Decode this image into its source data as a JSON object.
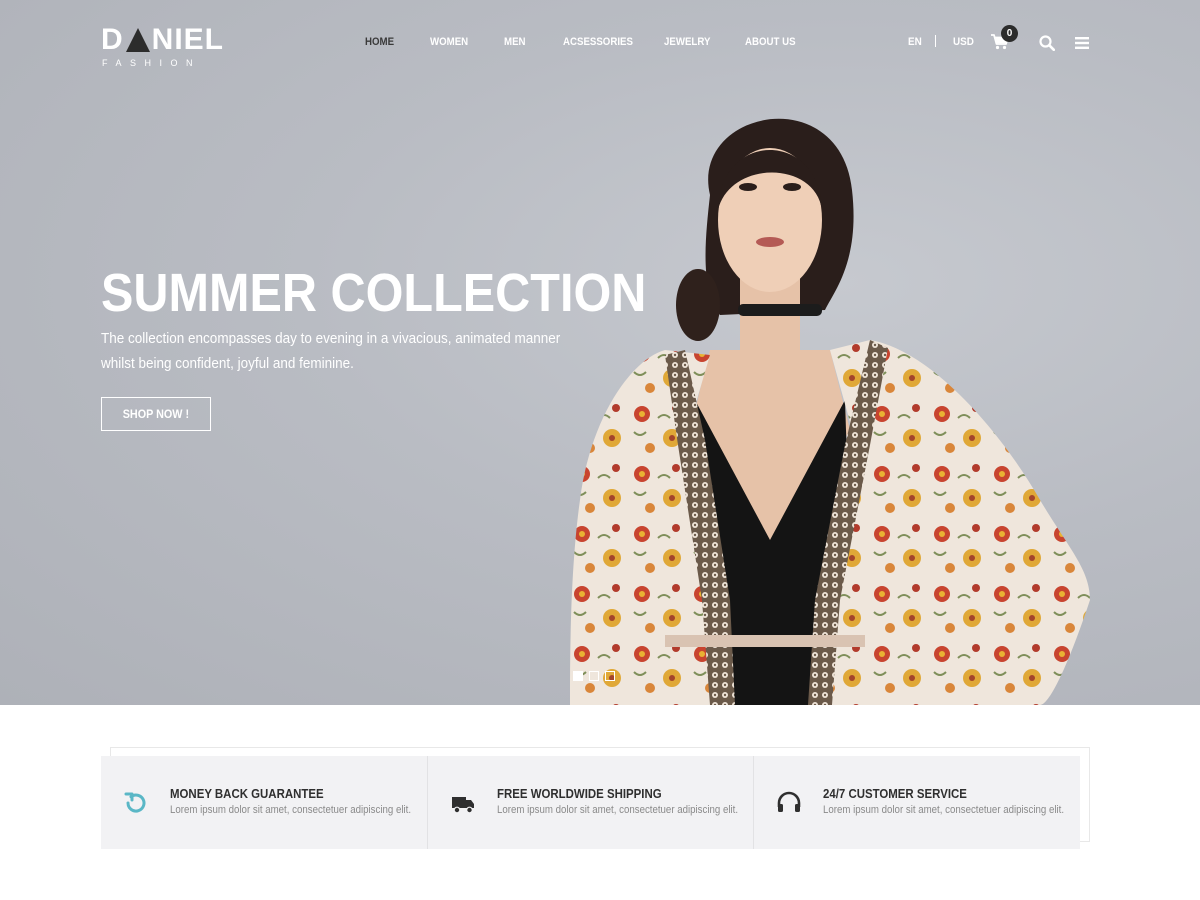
{
  "brand": {
    "name_left": "D",
    "name_right": "NIEL",
    "subtitle": "FASHION"
  },
  "nav": {
    "items": [
      {
        "label": "HOME",
        "active": true
      },
      {
        "label": "WOMEN"
      },
      {
        "label": "MEN"
      },
      {
        "label": "ACSESSORIES"
      },
      {
        "label": "JEWELRY"
      },
      {
        "label": "ABOUT US"
      }
    ]
  },
  "utility": {
    "language": "EN",
    "currency": "USD",
    "cart_count": "0"
  },
  "hero": {
    "title": "SUMMER COLLECTION",
    "description": "The collection encompasses day to evening in a vivacious, animated manner whilst being confident, joyful and feminine.",
    "button": "SHOP NOW !",
    "slides": 3,
    "active_slide": 1
  },
  "features": [
    {
      "icon": "refresh-icon",
      "title": "MONEY BACK GUARANTEE",
      "text": "Lorem ipsum dolor sit amet, consectetuer adipiscing elit."
    },
    {
      "icon": "truck-icon",
      "title": "FREE WORLDWIDE SHIPPING",
      "text": "Lorem ipsum dolor sit amet, consectetuer adipiscing elit."
    },
    {
      "icon": "headphones-icon",
      "title": "24/7 CUSTOMER SERVICE",
      "text": "Lorem ipsum dolor sit amet, consectetuer adipiscing elit."
    }
  ],
  "colors": {
    "accent": "#5ab7c6",
    "dark": "#2c2c2c",
    "hero_bg": "#b9bcc3"
  }
}
